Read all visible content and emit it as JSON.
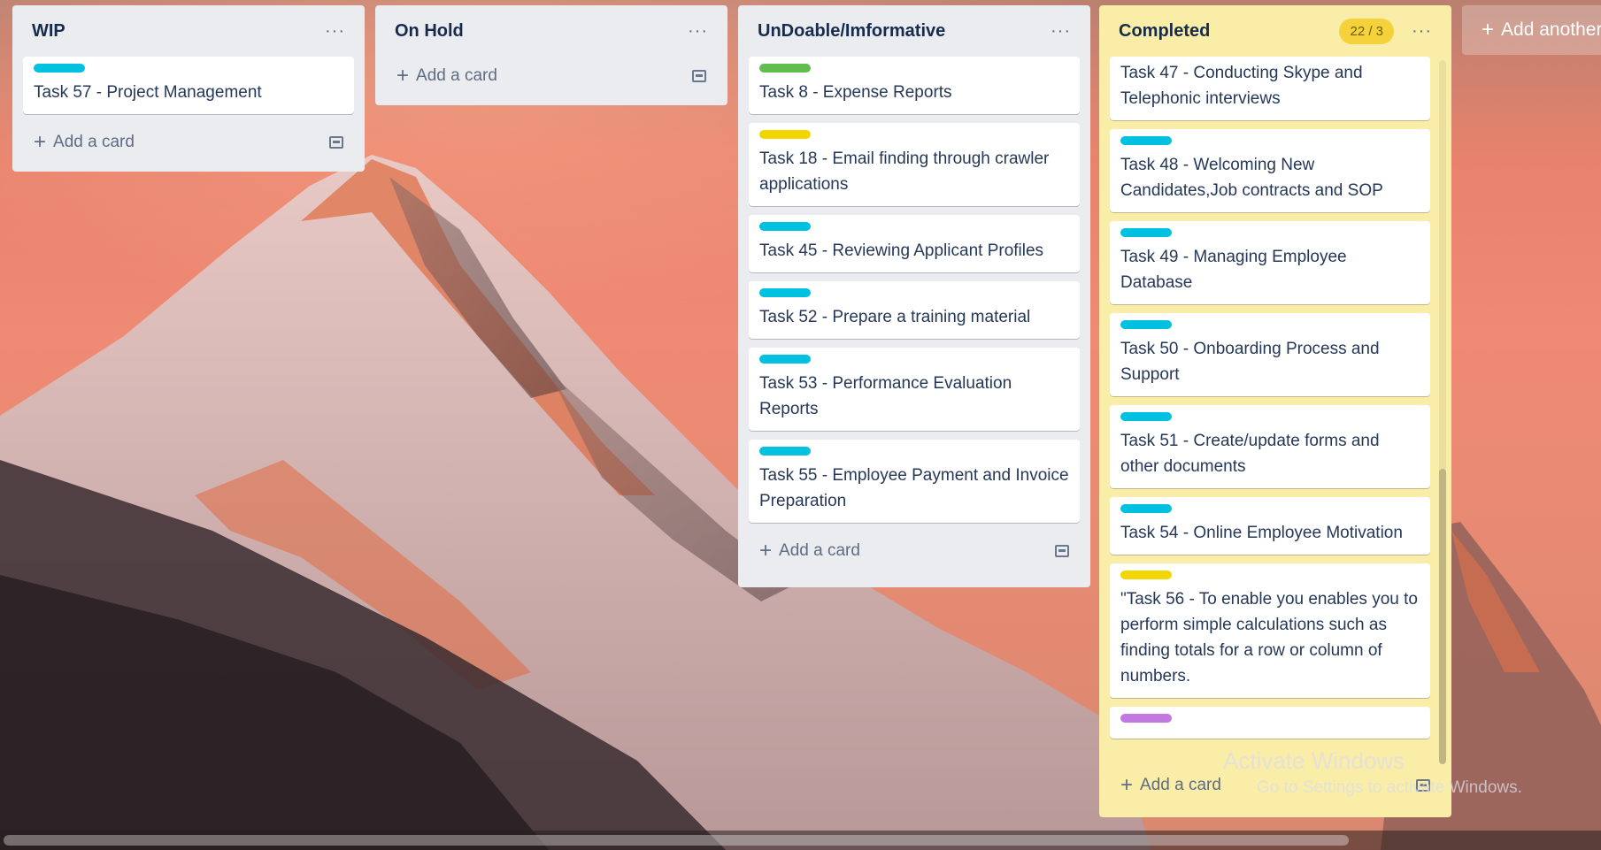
{
  "lists": [
    {
      "title": "WIP",
      "cards": [
        {
          "label_color": "#00c2e0",
          "text": "Task 57 - Project Management"
        }
      ],
      "add_card_label": "Add a card"
    },
    {
      "title": "On Hold",
      "cards": [],
      "add_card_label": "Add a card"
    },
    {
      "title": "UnDoable/Imformative",
      "cards": [
        {
          "label_color": "#61bd4f",
          "text": "Task 8 - Expense Reports"
        },
        {
          "label_color": "#f2d600",
          "text": "Task 18 - Email finding through crawler applications"
        },
        {
          "label_color": "#00c2e0",
          "text": "Task 45 - Reviewing Applicant Profiles"
        },
        {
          "label_color": "#00c2e0",
          "text": "Task 52 - Prepare a training material"
        },
        {
          "label_color": "#00c2e0",
          "text": "Task 53 - Performance Evaluation Reports"
        },
        {
          "label_color": "#00c2e0",
          "text": "Task 55 - Employee Payment and Invoice Preparation"
        }
      ],
      "add_card_label": "Add a card"
    },
    {
      "title": "Completed",
      "count": "22 / 3",
      "cards": [
        {
          "label_color": "#00c2e0",
          "text": "Task 47 - Conducting Skype and Telephonic interviews"
        },
        {
          "label_color": "#00c2e0",
          "text": "Task 48 - Welcoming New Candidates,Job contracts and SOP"
        },
        {
          "label_color": "#00c2e0",
          "text": "Task 49 - Managing Employee Database"
        },
        {
          "label_color": "#00c2e0",
          "text": "Task 50 - Onboarding Process and Support"
        },
        {
          "label_color": "#00c2e0",
          "text": "Task 51 - Create/update forms and other documents"
        },
        {
          "label_color": "#00c2e0",
          "text": "Task 54 - Online Employee Motivation"
        },
        {
          "label_color": "#f2d600",
          "text": "\"Task 56 - To enable you enables you to perform simple calculations such as finding totals for a row or column of numbers."
        },
        {
          "label_color": "#c377e0",
          "text": ""
        }
      ],
      "add_card_label": "Add a card"
    }
  ],
  "add_list_label": "Add another list",
  "watermark": {
    "title": "Activate Windows",
    "subtitle": "Go to Settings to activate Windows."
  },
  "icons": {
    "list_menu": "more-horizontal-icon",
    "add": "plus-icon",
    "template": "card-template-icon"
  }
}
